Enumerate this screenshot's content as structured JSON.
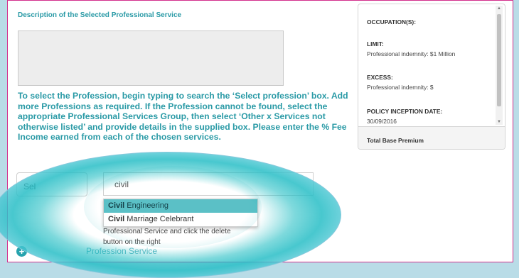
{
  "description": {
    "title": "Description of the Selected Professional Service"
  },
  "instructions": "To select the Profession, begin typing to search the ‘Select profession’ box. Add more Professions as required. If the Profession cannot be found, select the appropriate Professional Services Group, then select ‘Other x Services not otherwise listed’ and provide details in the supplied box. Please enter the % Fee Income earned from each of the chosen services.",
  "form": {
    "select_button_label": "Sel",
    "search_value": "civil",
    "dropdown_options": [
      {
        "match": "Civil",
        "rest": " Engineering",
        "active": true
      },
      {
        "match": "Civil",
        "rest": " Marriage Celebrant",
        "active": false
      }
    ],
    "helper_text": "Professional Service and click the delete button on the right",
    "add_label": "Profession Service",
    "add_icon": "plus-icon"
  },
  "summary_panel": {
    "occupation_label": "OCCUPATION(S):",
    "limit_label": "LIMIT:",
    "limit_value": "Professional indemnity: $1 Million",
    "excess_label": "EXCESS:",
    "excess_value": "Professional indemnity: $",
    "inception_label": "POLICY INCEPTION DATE:",
    "inception_value": "30/09/2016",
    "footer_label": "Total Base Premium"
  },
  "colors": {
    "accent": "#2a9aa6",
    "highlight": "#5bc0c6",
    "frame_border": "#d3308d",
    "overlay": "#18b9be"
  }
}
